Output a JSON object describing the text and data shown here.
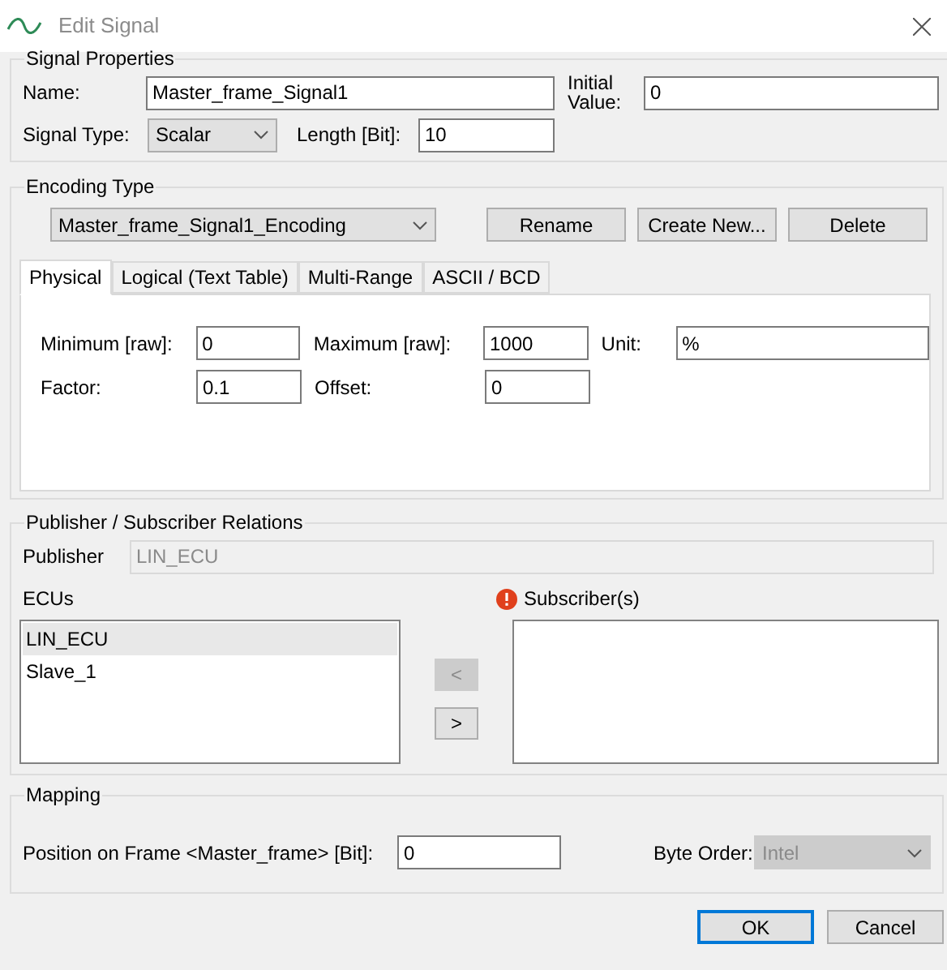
{
  "window": {
    "title": "Edit Signal"
  },
  "signal_properties": {
    "title": "Signal Properties",
    "name": {
      "label": "Name:",
      "value": "Master_frame_Signal1"
    },
    "initial_value": {
      "label": "Initial Value:",
      "value": "0"
    },
    "signal_type": {
      "label": "Signal Type:",
      "value": "Scalar"
    },
    "length": {
      "label": "Length [Bit]:",
      "value": "10"
    }
  },
  "encoding_type": {
    "title": "Encoding Type",
    "encoding": "Master_frame_Signal1_Encoding",
    "buttons": [
      "Rename",
      "Create New...",
      "Delete"
    ],
    "tabs": [
      {
        "label": "Physical",
        "selected": true
      },
      {
        "label": "Logical (Text Table)",
        "selected": false
      },
      {
        "label": "Multi-Range",
        "selected": false
      },
      {
        "label": "ASCII / BCD",
        "selected": false
      }
    ],
    "rows": [
      [
        {
          "label": "Minimum [raw]:",
          "value": "0"
        },
        {
          "label": "Maximum [raw]:",
          "value": "1000"
        },
        {
          "label": "Unit:",
          "value": "%"
        }
      ],
      [
        {
          "label": "Factor:",
          "value": "0.1"
        },
        {
          "label": "Offset:",
          "value": "0"
        }
      ]
    ]
  },
  "relations": {
    "title": "Publisher / Subscriber Relations",
    "publisher": {
      "label": "Publisher",
      "value": "LIN_ECU",
      "disabled": true
    },
    "ecus": {
      "label": "ECUs",
      "items": [
        {
          "label": "LIN_ECU",
          "selected": true
        },
        {
          "label": "Slave_1",
          "selected": false
        }
      ]
    },
    "subscribers": {
      "label": "Subscriber(s)"
    },
    "move_buttons": [
      {
        "label": "<",
        "disabled": true
      },
      {
        "label": ">",
        "disabled": false
      }
    ]
  },
  "mapping": {
    "title": "Mapping",
    "position": {
      "label": "Position on Frame <Master_frame> [Bit]:",
      "value": "0"
    },
    "byte_order": {
      "label": "Byte Order:",
      "value": "Intel",
      "disabled": true
    }
  },
  "buttons": [
    {
      "label": "OK",
      "default": true
    },
    {
      "label": "Cancel",
      "default": false
    }
  ]
}
